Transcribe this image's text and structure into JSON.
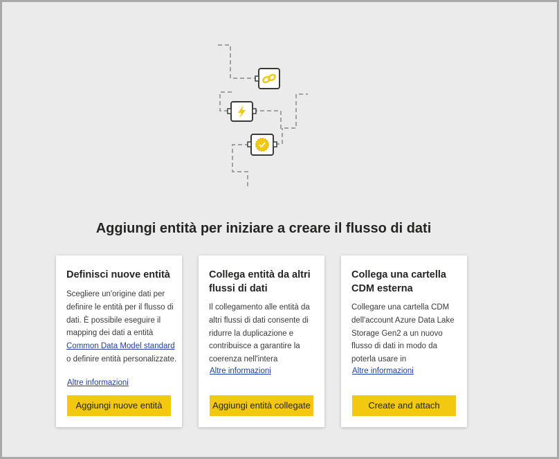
{
  "heading": "Aggiungi entità per iniziare a creare il flusso di dati",
  "illustration": {
    "icons": [
      "link-icon",
      "lightning-icon",
      "badge-check-icon"
    ],
    "accent_color": "#f2c811",
    "line_color": "#a0a0a0"
  },
  "cards": [
    {
      "title": "Definisci nuove entità",
      "desc_pre": "Scegliere un'origine dati per definire le entità per il flusso di dati. È possibile eseguire il mapping dei dati a entità ",
      "desc_link": "Common Data Model standard",
      "desc_post": " o definire entità personalizzate.",
      "more": "Altre informazioni",
      "button": "Aggiungi nuove entità"
    },
    {
      "title": "Collega entità da altri flussi di dati",
      "desc": "Il collegamento alle entità da altri flussi di dati consente di ridurre la duplicazione e contribuisce a garantire la coerenza nell'intera",
      "more": "Altre informazioni",
      "button": "Aggiungi entità collegate"
    },
    {
      "title": "Collega una cartella CDM esterna",
      "desc": "Collegare una cartella CDM dell'account Azure Data Lake Storage Gen2 a un nuovo flusso di dati in modo da poterla usare in",
      "more": "Altre informazioni",
      "button": "Create and attach"
    }
  ],
  "colors": {
    "background": "#ebebeb",
    "button": "#f2c811",
    "link": "#1f3fa8",
    "frame_border": "#a8a8a8"
  }
}
